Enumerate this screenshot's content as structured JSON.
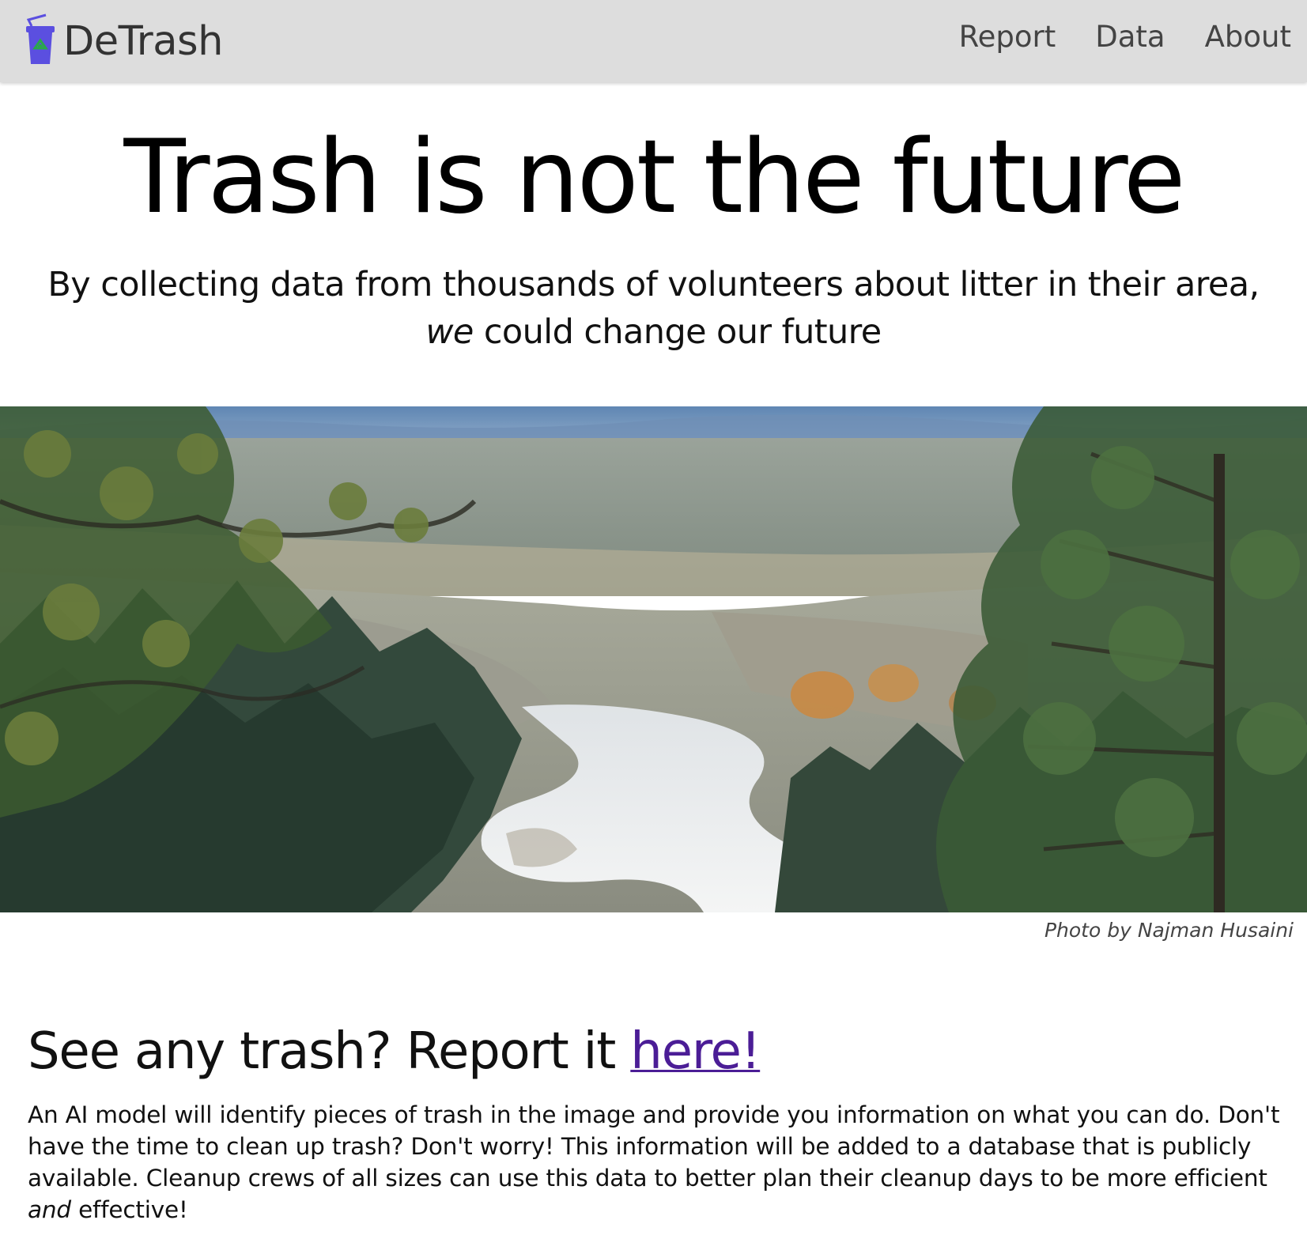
{
  "navbar": {
    "brand_name": "DeTrash",
    "logo_icon": "recycle-bin-cup-icon",
    "links": [
      {
        "label": "Report"
      },
      {
        "label": "Data"
      },
      {
        "label": "About"
      }
    ]
  },
  "hero": {
    "title": "Trash is not the future",
    "subtitle_part1": "By collecting data from thousands of volunteers about litter in their area,",
    "subtitle_emphasis": "we",
    "subtitle_part2": "could change our future"
  },
  "photo": {
    "credit": "Photo by Najman Husaini"
  },
  "report": {
    "heading_prefix": "See any trash? Report it ",
    "heading_link": "here!",
    "body_part1": "An AI model will identify pieces of trash in the image and provide you information on what you can do. Don't have the time to clean up trash? Don't worry! This information will be added to a database that is publicly available. Cleanup crews of all sizes can use this data to better plan their cleanup days to be more efficient ",
    "body_emphasis": "and",
    "body_part2": " effective!"
  },
  "colors": {
    "navbar_bg": "#dddddd",
    "link_purple": "#4b1d96",
    "logo_blue": "#5b4fe0",
    "logo_green": "#2aa84a"
  }
}
